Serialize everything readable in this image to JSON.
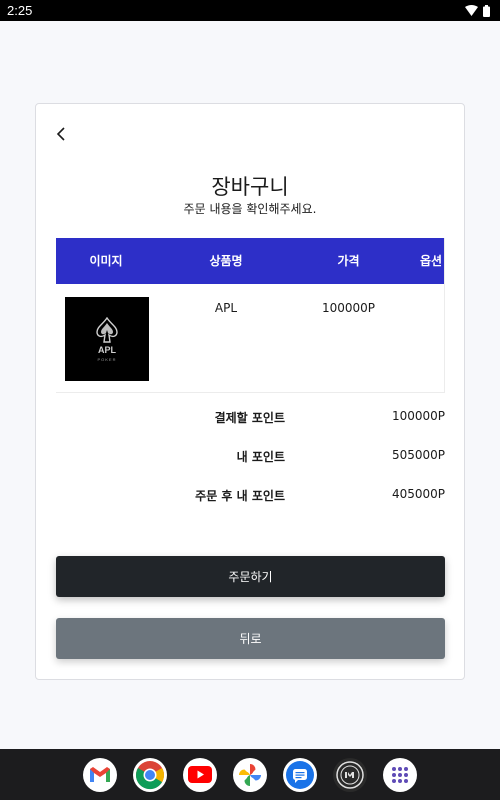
{
  "status_bar": {
    "time": "2:25"
  },
  "page": {
    "title": "장바구니",
    "subtitle": "주문 내용을 확인해주세요."
  },
  "table": {
    "headers": [
      "이미지",
      "상품명",
      "가격",
      "옵션"
    ],
    "rows": [
      {
        "thumb_text": "APL",
        "thumb_sub": "POKER",
        "name": "APL",
        "price": "100000P"
      }
    ]
  },
  "summary": [
    {
      "label": "결제할 포인트",
      "value": "100000P"
    },
    {
      "label": "내 포인트",
      "value": "505000P"
    },
    {
      "label": "주문 후 내 포인트",
      "value": "405000P"
    }
  ],
  "buttons": {
    "order": "주문하기",
    "back": "뒤로"
  },
  "dock": [
    "gmail-icon",
    "chrome-icon",
    "youtube-icon",
    "photos-icon",
    "messages-icon",
    "app-icon",
    "app-drawer-icon"
  ],
  "colors": {
    "table_header": "#2d2fc8",
    "order_button": "#212529",
    "back_button": "#6c757d"
  }
}
